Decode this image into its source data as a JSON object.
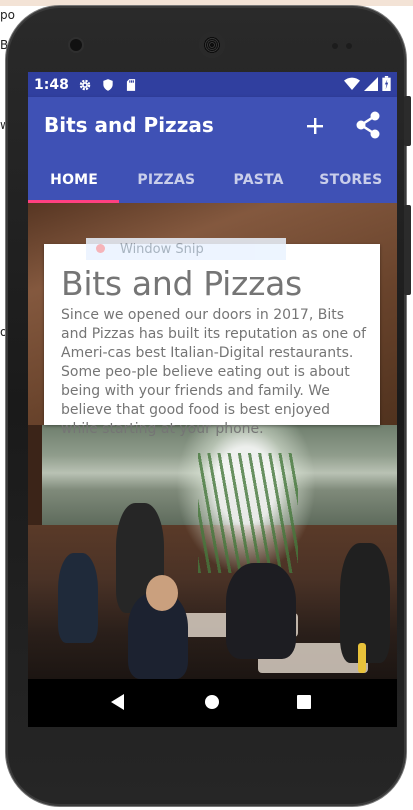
{
  "status_bar": {
    "time": "1:48",
    "icons": [
      "settings-icon",
      "shield-icon",
      "sd-card-icon",
      "wifi-icon",
      "signal-icon",
      "battery-icon"
    ]
  },
  "app_bar": {
    "title": "Bits and Pizzas",
    "actions": [
      "add-icon",
      "share-icon"
    ]
  },
  "tabs": [
    {
      "label": "HOME",
      "active": true
    },
    {
      "label": "PIZZAS",
      "active": false
    },
    {
      "label": "PASTA",
      "active": false
    },
    {
      "label": "STORES",
      "active": false
    }
  ],
  "home_card": {
    "title": "Bits and Pizzas",
    "body": "Since we opened our doors in 2017, Bits and Pizzas has built its reputation as one of Ameri-cas best Italian-Digital restaurants. Some peo-ple believe eating out is about being with your friends and family. We believe that good food is best enjoyed while starting at your phone.",
    "ghost_label": "Window Snip"
  },
  "desktop_fragments": {
    "top_left": "po",
    "left_b": "B",
    "left_w": "w",
    "left_o": "o",
    "right_o": "o"
  },
  "colors": {
    "status_bar": "#303f9f",
    "app_bar": "#3f51b5",
    "tab_indicator": "#ff4081",
    "card_text": "#757575"
  },
  "navigation": [
    "back-icon",
    "home-icon",
    "recents-icon"
  ]
}
